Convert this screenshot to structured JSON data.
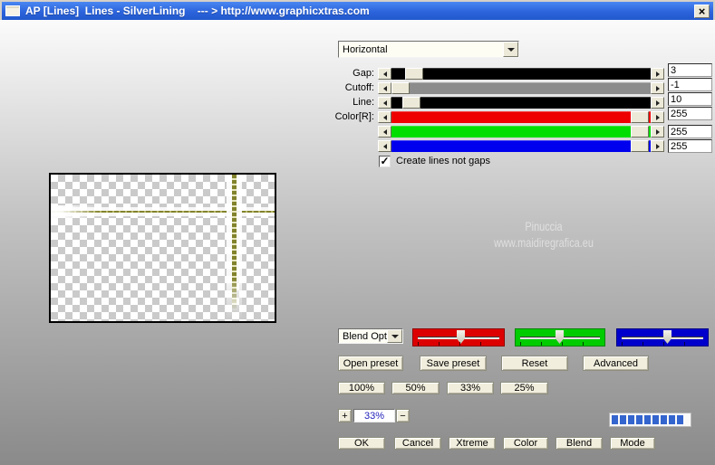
{
  "window": {
    "title": "AP [Lines]  Lines - SilverLining    --- > http://www.graphicxtras.com",
    "close_glyph": "×"
  },
  "watermark": {
    "line1": "Pinuccia",
    "line2": "www.maidiregrafica.eu"
  },
  "panel": {
    "mode_select": {
      "value": "Horizontal"
    },
    "sliders": [
      {
        "label": "Gap:",
        "value": "3",
        "track_color": "#000000"
      },
      {
        "label": "Cutoff:",
        "value": "-1",
        "track_color": "#8c8c8c"
      },
      {
        "label": "Line:",
        "value": "10",
        "track_color": "#000000"
      },
      {
        "label": "Color[R]:",
        "value": "255",
        "track_color": "#ee0000"
      },
      {
        "label": "",
        "value": "255",
        "track_color": "#00dd00"
      },
      {
        "label": "",
        "value": "255",
        "track_color": "#0000ee"
      }
    ],
    "create_lines_checkbox": {
      "label": "Create lines not gaps",
      "checked": true,
      "check_glyph": "✓"
    },
    "blend_select": {
      "value": "Blend Opti"
    },
    "channel_mixers": [
      {
        "name": "red",
        "color": "#dd0000"
      },
      {
        "name": "green",
        "color": "#00cc00"
      },
      {
        "name": "blue",
        "color": "#0000cc"
      }
    ],
    "preset_buttons": [
      "Open preset",
      "Save preset",
      "Reset",
      "Advanced"
    ],
    "zoom_buttons": [
      "100%",
      "50%",
      "33%",
      "25%"
    ],
    "zoom_control": {
      "plus": "+",
      "value": "33%",
      "minus": "−"
    },
    "progress": {
      "segments": 9,
      "color": "#3464ce"
    },
    "action_buttons": [
      "OK",
      "Cancel",
      "Xtreme",
      "Color",
      "Blend",
      "Mode"
    ]
  }
}
